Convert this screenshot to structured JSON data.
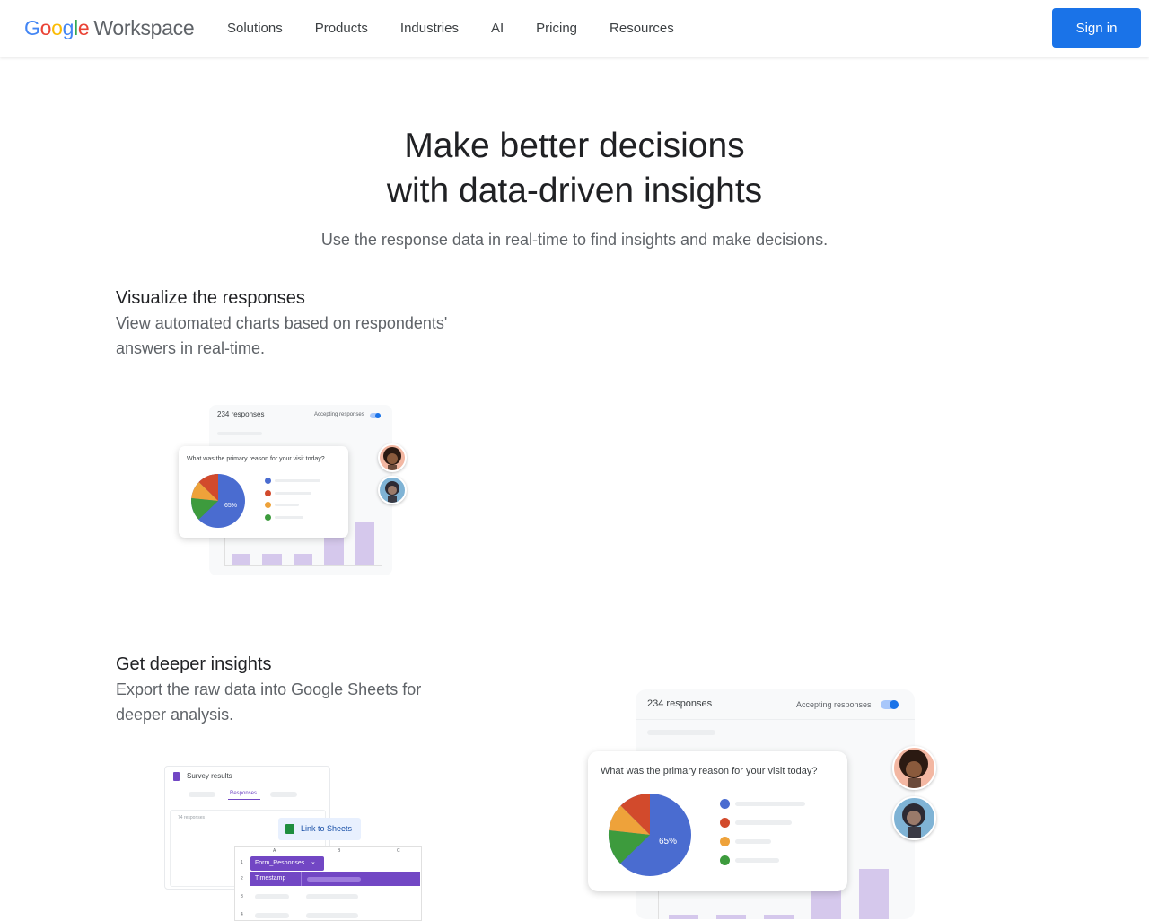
{
  "header": {
    "logo": {
      "google": "Google",
      "product": "Workspace"
    },
    "nav": [
      "Solutions",
      "Products",
      "Industries",
      "AI",
      "Pricing",
      "Resources"
    ],
    "sign_in": "Sign in"
  },
  "hero": {
    "title_line1": "Make better decisions",
    "title_line2": "with data-driven insights",
    "subtitle": "Use the response data in real-time to find insights and make decisions."
  },
  "feature1": {
    "title": "Visualize the responses",
    "description": "View automated charts based on respondents' answers in real-time.",
    "illustration": {
      "responses": "234 responses",
      "accepting": "Accepting responses",
      "question": "What was the primary reason for your visit today?",
      "pie_label": "65%"
    }
  },
  "feature2": {
    "title": "Get deeper insights",
    "description": "Export the raw data into Google Sheets for deeper analysis.",
    "illustration": {
      "doc_title": "Survey results",
      "tab": "Responses",
      "count": "74 responses",
      "link_button": "Link to Sheets",
      "columns": [
        "A",
        "B",
        "C"
      ],
      "rows": [
        "1",
        "2",
        "3",
        "4"
      ],
      "sheet_name": "Form_Responses",
      "timestamp": "Timestamp"
    }
  },
  "large_illustration": {
    "responses": "234 responses",
    "accepting": "Accepting responses",
    "question": "What was the primary reason for your visit today?",
    "pie_label": "65%"
  },
  "colors": {
    "brand_blue": "#1a73e8",
    "pie_blue": "#4a6cd0",
    "pie_red": "#d24a2c",
    "pie_orange": "#eea23a",
    "pie_green": "#3d9b3d",
    "sheets_purple": "#7247c4"
  }
}
